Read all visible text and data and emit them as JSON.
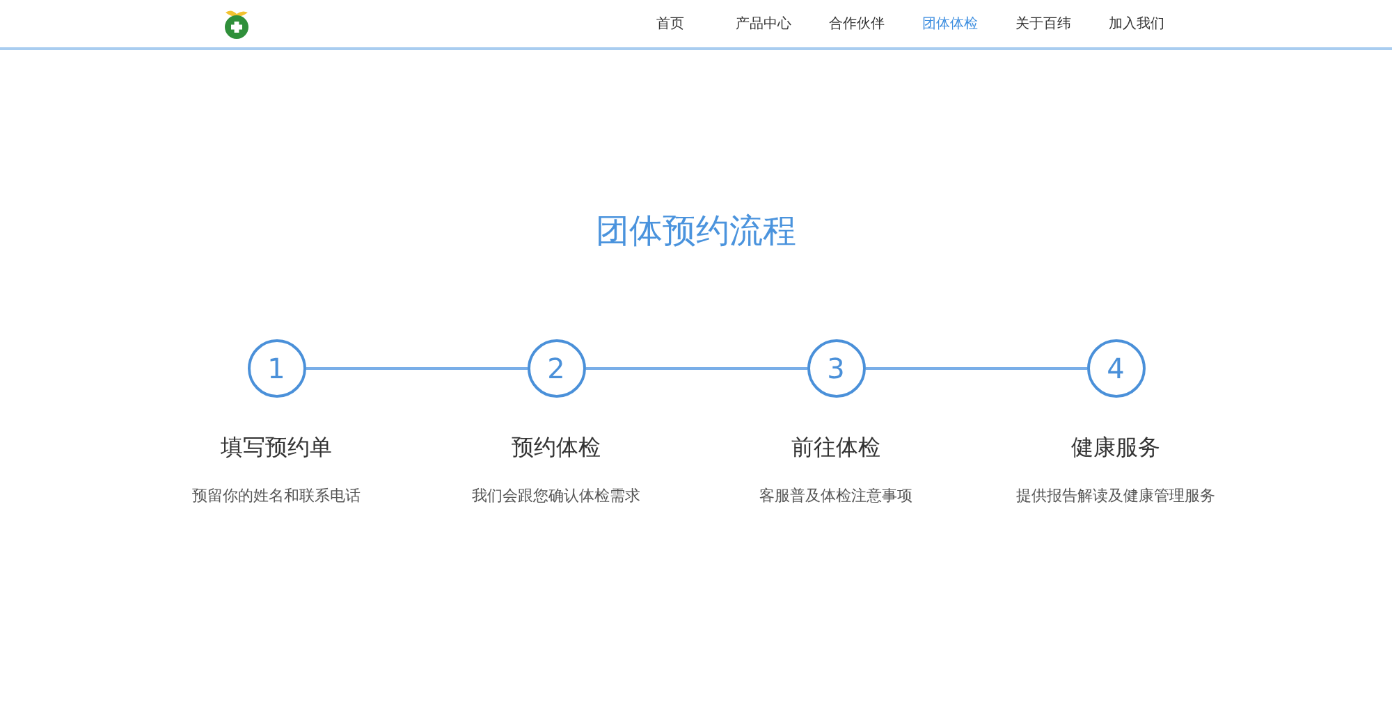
{
  "nav": {
    "items": [
      {
        "label": "首页",
        "selected": false
      },
      {
        "label": "产品中心",
        "selected": false
      },
      {
        "label": "合作伙伴",
        "selected": false
      },
      {
        "label": "团体体检",
        "selected": true
      },
      {
        "label": "关于百纬",
        "selected": false
      },
      {
        "label": "加入我们",
        "selected": false
      }
    ]
  },
  "section": {
    "title": "团体预约流程",
    "steps": [
      {
        "number": "1",
        "title": "填写预约单",
        "description": "预留你的姓名和联系电话"
      },
      {
        "number": "2",
        "title": "预约体检",
        "description": "我们会跟您确认体检需求"
      },
      {
        "number": "3",
        "title": "前往体检",
        "description": "客服普及体检注意事项"
      },
      {
        "number": "4",
        "title": "健康服务",
        "description": "提供报告解读及健康管理服务"
      }
    ]
  }
}
